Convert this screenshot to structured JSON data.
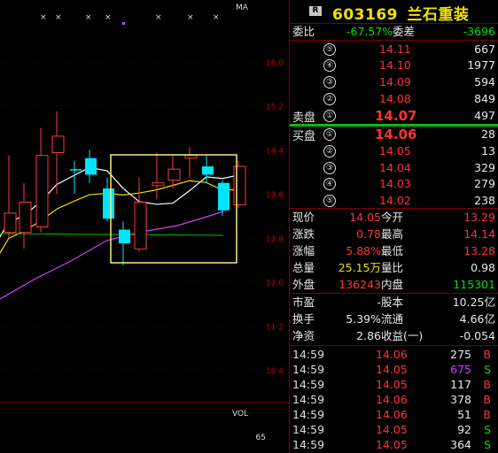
{
  "chart": {
    "ma_label": "MA",
    "vol_label": "VOL",
    "vol_value": "65",
    "y_labels": [
      "16.0",
      "15.2",
      "14.4",
      "13.6",
      "12.8",
      "12.0",
      "11.2",
      "10.4"
    ],
    "candles": [
      {
        "o": 12.9,
        "c": 13.25,
        "h": 14.3,
        "l": 12.8,
        "up": true
      },
      {
        "o": 12.9,
        "c": 13.45,
        "h": 13.8,
        "l": 12.6,
        "up": true
      },
      {
        "o": 13.0,
        "c": 14.3,
        "h": 14.8,
        "l": 12.9,
        "up": true
      },
      {
        "o": 14.35,
        "c": 14.65,
        "h": 15.1,
        "l": 13.6,
        "up": true
      },
      {
        "o": 14.05,
        "c": 14.05,
        "h": 14.2,
        "l": 13.6,
        "up": false
      },
      {
        "o": 14.25,
        "c": 13.95,
        "h": 14.4,
        "l": 13.8,
        "up": false
      },
      {
        "o": 13.7,
        "c": 13.15,
        "h": 13.9,
        "l": 13.1,
        "up": false
      },
      {
        "o": 12.95,
        "c": 12.7,
        "h": 13.1,
        "l": 12.3,
        "up": false
      },
      {
        "o": 12.6,
        "c": 13.45,
        "h": 13.9,
        "l": 12.55,
        "up": true
      },
      {
        "o": 13.75,
        "c": 13.8,
        "h": 14.35,
        "l": 13.5,
        "up": true
      },
      {
        "o": 13.85,
        "c": 14.05,
        "h": 14.3,
        "l": 13.7,
        "up": true
      },
      {
        "o": 14.25,
        "c": 14.3,
        "h": 14.45,
        "l": 13.9,
        "up": true
      },
      {
        "o": 14.1,
        "c": 13.95,
        "h": 14.3,
        "l": 13.8,
        "up": false
      },
      {
        "o": 13.8,
        "c": 13.3,
        "h": 13.85,
        "l": 13.2,
        "up": false
      },
      {
        "o": 13.4,
        "c": 14.1,
        "h": 14.2,
        "l": 13.35,
        "up": true
      }
    ]
  },
  "header": {
    "badge": "R",
    "code": "603169",
    "name": "兰石重装"
  },
  "summary": {
    "weibi_label": "委比",
    "weibi_value": "-67.57%",
    "weicha_label": "委差",
    "weicha_value": "-3696"
  },
  "sell": [
    {
      "level": "⑤",
      "price": "14.11",
      "vol": "667"
    },
    {
      "level": "④",
      "price": "14.10",
      "vol": "1977"
    },
    {
      "level": "③",
      "price": "14.09",
      "vol": "594"
    },
    {
      "level": "②",
      "price": "14.08",
      "vol": "849"
    },
    {
      "level": "①",
      "price": "14.07",
      "vol": "497"
    }
  ],
  "sell_label": "卖盘",
  "buy_label": "买盘",
  "buy": [
    {
      "level": "①",
      "price": "14.06",
      "vol": "28"
    },
    {
      "level": "②",
      "price": "14.05",
      "vol": "13"
    },
    {
      "level": "③",
      "price": "14.04",
      "vol": "329"
    },
    {
      "level": "④",
      "price": "14.03",
      "vol": "279"
    },
    {
      "level": "⑤",
      "price": "14.02",
      "vol": "238"
    }
  ],
  "stats": {
    "xianjia_l": "现价",
    "xianjia_v": "14.05",
    "jinkai_l": "今开",
    "jinkai_v": "13.29",
    "zhangdie_l": "涨跌",
    "zhangdie_v": "0.78",
    "zuigao_l": "最高",
    "zuigao_v": "14.14",
    "zhangfu_l": "涨幅",
    "zhangfu_v": "5.88%",
    "zuidi_l": "最低",
    "zuidi_v": "13.28",
    "zongliang_l": "总量",
    "zongliang_v": "25.15万",
    "liangbi_l": "量比",
    "liangbi_v": "0.98",
    "waipan_l": "外盘",
    "waipan_v": "136243",
    "neipan_l": "内盘",
    "neipan_v": "115301",
    "shiying_l": "市盈",
    "shiying_v": "-",
    "guben_l": "股本",
    "guben_v": "10.25亿",
    "huanshou_l": "换手",
    "huanshou_v": "5.39%",
    "liutong_l": "流通",
    "liutong_v": "4.66亿",
    "jingzi_l": "净资",
    "jingzi_v": "2.86",
    "shouyi_l": "收益(一)",
    "shouyi_v": "-0.054"
  },
  "ticks": [
    {
      "time": "14:59",
      "price": "14.06",
      "vol": "275",
      "side": "B"
    },
    {
      "time": "14:59",
      "price": "14.05",
      "vol": "675",
      "side": "S"
    },
    {
      "time": "14:59",
      "price": "14.05",
      "vol": "117",
      "side": "B"
    },
    {
      "time": "14:59",
      "price": "14.06",
      "vol": "378",
      "side": "B"
    },
    {
      "time": "14:59",
      "price": "14.06",
      "vol": "51",
      "side": "B"
    },
    {
      "time": "14:59",
      "price": "14.05",
      "vol": "92",
      "side": "S"
    },
    {
      "time": "14:59",
      "price": "14.05",
      "vol": "364",
      "side": "S"
    }
  ]
}
